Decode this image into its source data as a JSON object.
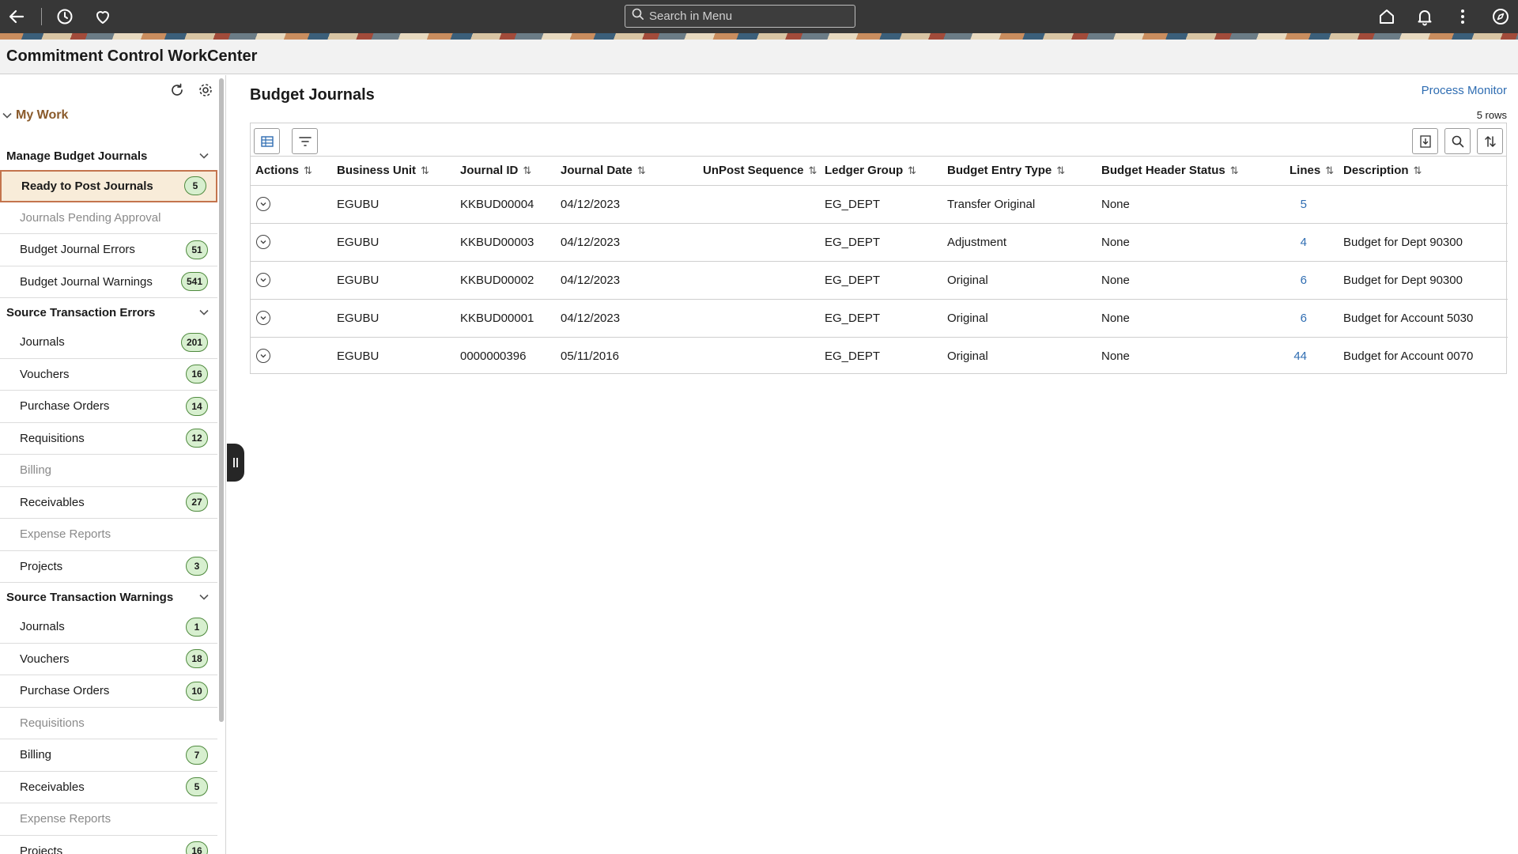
{
  "topbar": {
    "search_placeholder": "Search in Menu"
  },
  "header": {
    "title": "Commitment Control WorkCenter"
  },
  "sidebar": {
    "section_title": "My Work",
    "groups": [
      {
        "title": "Manage Budget Journals",
        "items": [
          {
            "label": "Ready to Post Journals",
            "badge": "5"
          },
          {
            "label": "Journals Pending Approval",
            "badge": ""
          },
          {
            "label": "Budget Journal Errors",
            "badge": "51"
          },
          {
            "label": "Budget Journal Warnings",
            "badge": "541"
          }
        ]
      },
      {
        "title": "Source Transaction Errors",
        "items": [
          {
            "label": "Journals",
            "badge": "201"
          },
          {
            "label": "Vouchers",
            "badge": "16"
          },
          {
            "label": "Purchase Orders",
            "badge": "14"
          },
          {
            "label": "Requisitions",
            "badge": "12"
          },
          {
            "label": "Billing",
            "badge": ""
          },
          {
            "label": "Receivables",
            "badge": "27"
          },
          {
            "label": "Expense Reports",
            "badge": ""
          },
          {
            "label": "Projects",
            "badge": "3"
          }
        ]
      },
      {
        "title": "Source Transaction Warnings",
        "items": [
          {
            "label": "Journals",
            "badge": "1"
          },
          {
            "label": "Vouchers",
            "badge": "18"
          },
          {
            "label": "Purchase Orders",
            "badge": "10"
          },
          {
            "label": "Requisitions",
            "badge": ""
          },
          {
            "label": "Billing",
            "badge": "7"
          },
          {
            "label": "Receivables",
            "badge": "5"
          },
          {
            "label": "Expense Reports",
            "badge": ""
          },
          {
            "label": "Projects",
            "badge": "16"
          }
        ]
      }
    ]
  },
  "main": {
    "title": "Budget Journals",
    "process_monitor": "Process Monitor",
    "rows_count": "5 rows",
    "columns": [
      "Actions",
      "Business Unit",
      "Journal ID",
      "Journal Date",
      "UnPost Sequence",
      "Ledger Group",
      "Budget Entry Type",
      "Budget Header Status",
      "Lines",
      "Description"
    ],
    "rows": [
      {
        "business_unit": "EGUBU",
        "journal_id": "KKBUD00004",
        "journal_date": "04/12/2023",
        "unpost_sequence": "",
        "ledger_group": "EG_DEPT",
        "entry_type": "Transfer Original",
        "header_status": "None",
        "lines": "5",
        "description": ""
      },
      {
        "business_unit": "EGUBU",
        "journal_id": "KKBUD00003",
        "journal_date": "04/12/2023",
        "unpost_sequence": "",
        "ledger_group": "EG_DEPT",
        "entry_type": "Adjustment",
        "header_status": "None",
        "lines": "4",
        "description": "Budget for Dept 90300"
      },
      {
        "business_unit": "EGUBU",
        "journal_id": "KKBUD00002",
        "journal_date": "04/12/2023",
        "unpost_sequence": "",
        "ledger_group": "EG_DEPT",
        "entry_type": "Original",
        "header_status": "None",
        "lines": "6",
        "description": "Budget for Dept 90300"
      },
      {
        "business_unit": "EGUBU",
        "journal_id": "KKBUD00001",
        "journal_date": "04/12/2023",
        "unpost_sequence": "",
        "ledger_group": "EG_DEPT",
        "entry_type": "Original",
        "header_status": "None",
        "lines": "6",
        "description": "Budget for Account 5030"
      },
      {
        "business_unit": "EGUBU",
        "journal_id": "0000000396",
        "journal_date": "05/11/2016",
        "unpost_sequence": "",
        "ledger_group": "EG_DEPT",
        "entry_type": "Original",
        "header_status": "None",
        "lines": "44",
        "description": "Budget for Account 0070"
      }
    ]
  }
}
